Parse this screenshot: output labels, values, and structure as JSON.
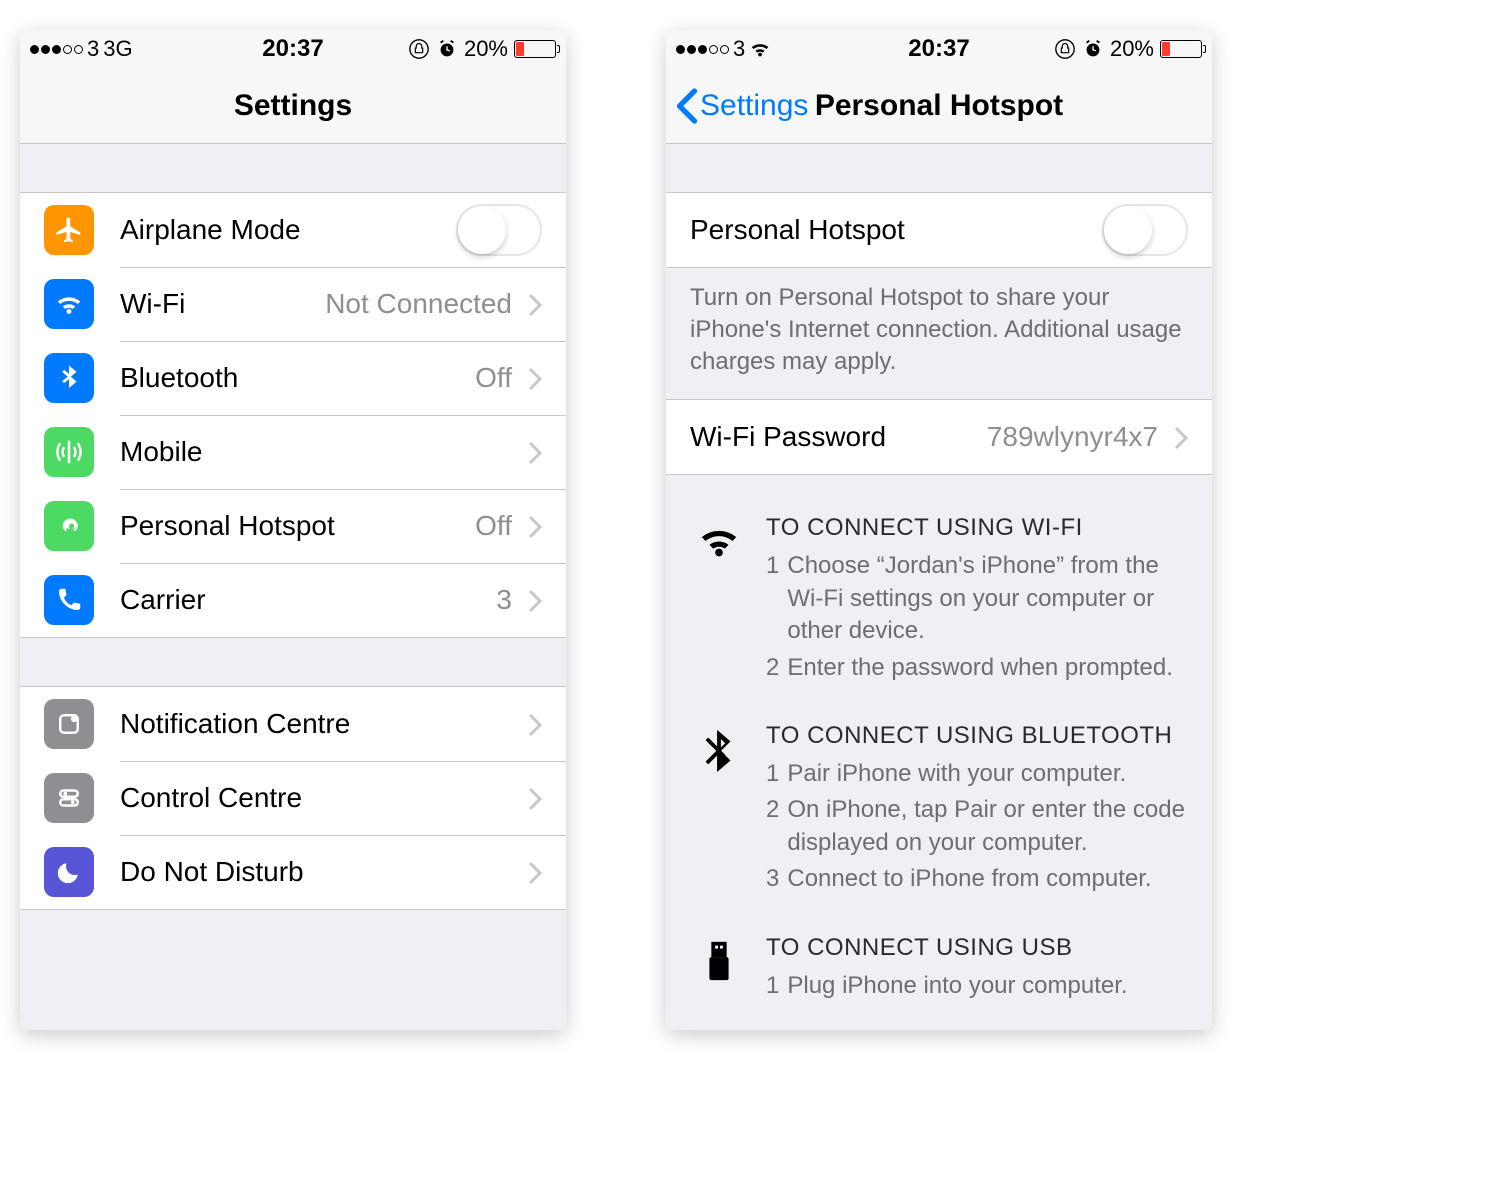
{
  "left": {
    "status": {
      "carrier": "3",
      "network": "3G",
      "time": "20:37",
      "battery_pct": "20%"
    },
    "navbar": {
      "title": "Settings"
    },
    "group1": [
      {
        "icon": "airplane",
        "color": "#ff9500",
        "label": "Airplane Mode",
        "ctl": "toggle"
      },
      {
        "icon": "wifi",
        "color": "#007aff",
        "label": "Wi-Fi",
        "value": "Not Connected"
      },
      {
        "icon": "bluetooth",
        "color": "#007aff",
        "label": "Bluetooth",
        "value": "Off"
      },
      {
        "icon": "mobile",
        "color": "#4cd964",
        "label": "Mobile",
        "value": ""
      },
      {
        "icon": "hotspot",
        "color": "#4cd964",
        "label": "Personal Hotspot",
        "value": "Off"
      },
      {
        "icon": "phone",
        "color": "#007aff",
        "label": "Carrier",
        "value": "3"
      }
    ],
    "group2": [
      {
        "icon": "notification",
        "color": "#8e8e93",
        "label": "Notification Centre"
      },
      {
        "icon": "control",
        "color": "#8e8e93",
        "label": "Control Centre"
      },
      {
        "icon": "dnd",
        "color": "#5856d6",
        "label": "Do Not Disturb"
      }
    ]
  },
  "right": {
    "status": {
      "carrier": "3",
      "time": "20:37",
      "battery_pct": "20%"
    },
    "navbar": {
      "back": "Settings",
      "title": "Personal Hotspot"
    },
    "toggle_row": {
      "label": "Personal Hotspot"
    },
    "footer": "Turn on Personal Hotspot to share your iPhone's Internet connection. Additional usage charges may apply.",
    "pw_row": {
      "label": "Wi-Fi Password",
      "value": "789wlynyr4x7"
    },
    "wifi": {
      "title": "TO CONNECT USING WI-FI",
      "s1": "Choose “Jordan's iPhone” from the Wi-Fi settings on your computer or other device.",
      "s2": "Enter the password when prompted."
    },
    "bt": {
      "title": "TO CONNECT USING BLUETOOTH",
      "s1": "Pair iPhone with your computer.",
      "s2": "On iPhone, tap Pair or enter the code displayed on your computer.",
      "s3": "Connect to iPhone from computer."
    },
    "usb": {
      "title": "TO CONNECT USING USB",
      "s1": "Plug iPhone into your computer."
    }
  }
}
